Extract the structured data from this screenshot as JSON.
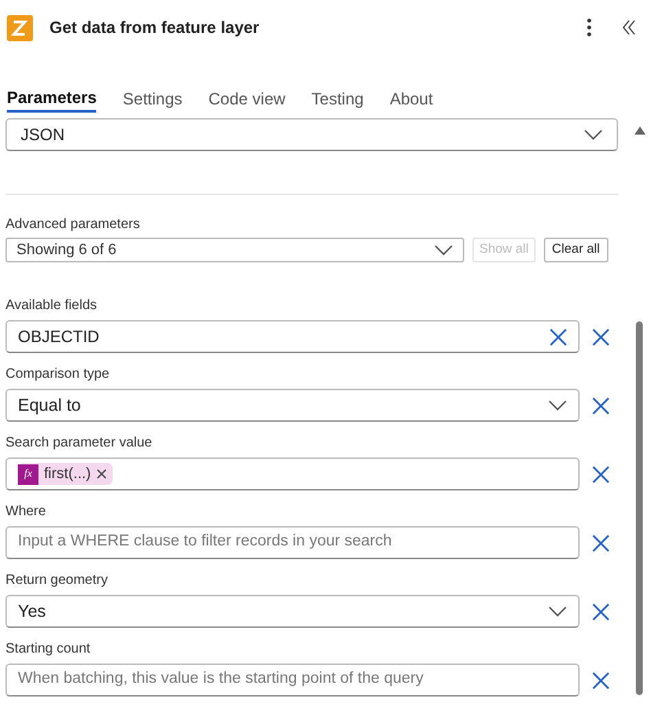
{
  "header": {
    "title": "Get data from feature layer"
  },
  "tabs": [
    {
      "label": "Parameters",
      "selected": true
    },
    {
      "label": "Settings",
      "selected": false
    },
    {
      "label": "Code view",
      "selected": false
    },
    {
      "label": "Testing",
      "selected": false
    },
    {
      "label": "About",
      "selected": false
    }
  ],
  "output_format": {
    "value": "JSON"
  },
  "advanced": {
    "label": "Advanced parameters",
    "value": "Showing 6 of 6",
    "show_all": {
      "label": "Show all",
      "disabled": true
    },
    "clear_all": {
      "label": "Clear all",
      "disabled": false
    }
  },
  "fields": [
    {
      "label": "Available fields",
      "kind": "clearable",
      "value": "OBJECTID"
    },
    {
      "label": "Comparison type",
      "kind": "dropdown",
      "value": "Equal to"
    },
    {
      "label": "Search parameter value",
      "kind": "token",
      "token_icon": "fx",
      "token": "first(...)"
    },
    {
      "label": "Where",
      "kind": "text",
      "placeholder": "Input a WHERE clause to filter records in your search"
    },
    {
      "label": "Return geometry",
      "kind": "dropdown",
      "value": "Yes"
    },
    {
      "label": "Starting count",
      "kind": "text",
      "placeholder": "When batching, this value is the starting point of the query"
    }
  ]
}
